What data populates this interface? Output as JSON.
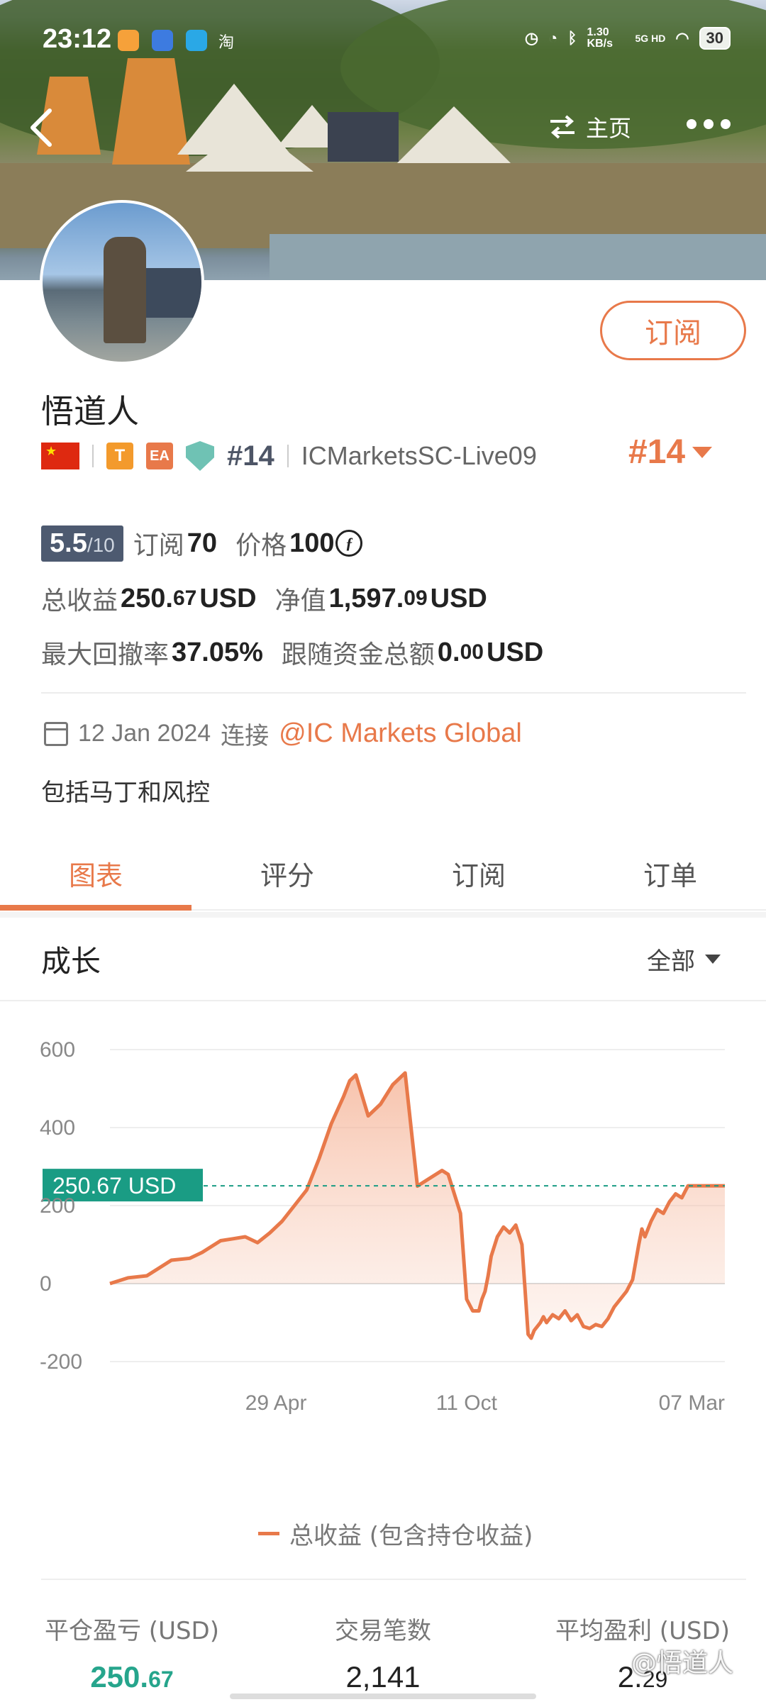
{
  "status_bar": {
    "time": "23:12",
    "net_speed": "1.30 KB/s",
    "signal": "5G HD",
    "battery": "30",
    "small_label": "淘"
  },
  "header": {
    "home_label": "主页",
    "icons": [
      "back-icon",
      "swap-icon",
      "more-icon"
    ]
  },
  "profile": {
    "name": "悟道人",
    "subscribe_button": "订阅",
    "tag_t": "T",
    "tag_ea": "EA",
    "rank": "#14",
    "server": "ICMarketsSC-Live09",
    "rank_right": "#14",
    "accent_color": "#e8794a"
  },
  "stats": {
    "score": "5.5",
    "score_max": "/10",
    "subscribe_label": "订阅",
    "subscribe_count": "70",
    "price_label": "价格",
    "price_value": "100",
    "price_currency_symbol": "ƒ",
    "total_profit_label": "总收益",
    "total_profit_int": "250.",
    "total_profit_dec": "67",
    "total_profit_unit": "USD",
    "equity_label": "净值",
    "equity_int": "1,597.",
    "equity_dec": "09",
    "equity_unit": "USD",
    "max_drawdown_label": "最大回撤率",
    "max_drawdown_value": "37.05%",
    "follow_label": "跟随资金总额",
    "follow_int": "0.",
    "follow_dec": "00",
    "follow_unit": "USD"
  },
  "connection": {
    "date": "12 Jan 2024",
    "connect_label": "连接",
    "broker": "@IC Markets Global",
    "description": "包括马丁和风控"
  },
  "tabs": [
    {
      "label": "图表",
      "active": true
    },
    {
      "label": "评分",
      "active": false
    },
    {
      "label": "订阅",
      "active": false
    },
    {
      "label": "订单",
      "active": false
    }
  ],
  "growth": {
    "title": "成长",
    "range_selector": "全部"
  },
  "chart_data": {
    "type": "area",
    "title": "",
    "ylabel": "",
    "xlabel": "",
    "ylim": [
      -200,
      600
    ],
    "yticks": [
      "600",
      "400",
      "200",
      "0",
      "-200"
    ],
    "xtick_labels": [
      "29 Apr",
      "11 Oct",
      "07 Mar"
    ],
    "current_value_label": "250.67 USD",
    "current_value": 250.67,
    "series": [
      {
        "name": "总收益 (包含持仓收益)",
        "color": "#e8794a",
        "x_index": [
          0,
          3,
          6,
          8,
          10,
          13,
          15,
          18,
          20,
          22,
          24,
          26,
          28,
          30,
          32,
          34,
          36,
          38,
          39,
          40,
          42,
          44,
          46,
          48,
          50,
          52,
          54,
          55,
          57,
          58,
          59,
          60,
          60.5,
          61,
          61.5,
          62,
          63,
          64,
          65,
          66,
          67,
          68,
          68.5,
          69,
          70,
          70.5,
          71,
          72,
          73,
          74,
          75,
          76,
          77,
          78,
          79,
          80,
          81,
          82,
          83,
          84,
          85,
          86,
          86.5,
          87,
          88,
          89,
          90,
          91,
          92,
          93,
          94,
          95,
          96,
          97,
          98,
          99,
          100
        ],
        "values": [
          0,
          15,
          20,
          40,
          60,
          65,
          80,
          110,
          115,
          120,
          105,
          130,
          160,
          200,
          240,
          320,
          410,
          480,
          520,
          535,
          430,
          460,
          510,
          540,
          250,
          270,
          290,
          280,
          180,
          -40,
          -70,
          -70,
          -40,
          -20,
          20,
          70,
          120,
          145,
          130,
          150,
          100,
          -130,
          -140,
          -120,
          -100,
          -85,
          -100,
          -80,
          -90,
          -70,
          -95,
          -80,
          -110,
          -115,
          -105,
          -110,
          -90,
          -60,
          -40,
          -20,
          10,
          100,
          140,
          120,
          160,
          190,
          180,
          210,
          230,
          220,
          250.67,
          250.67,
          250.67,
          250.67,
          250.67,
          250.67,
          250.67
        ]
      }
    ],
    "dashed_line_value": 250.67,
    "grid": true,
    "legend_position": "bottom"
  },
  "legend": {
    "label": "总收益 (包含持仓收益)"
  },
  "metrics": [
    {
      "label": "平仓盈亏 (USD)",
      "value_int": "250.",
      "value_dec": "67"
    },
    {
      "label": "交易笔数",
      "value_int": "2,141",
      "value_dec": ""
    },
    {
      "label": "平均盈利 (USD)",
      "value_int": "2.",
      "value_dec": "29"
    }
  ],
  "watermark": "@悟道人"
}
